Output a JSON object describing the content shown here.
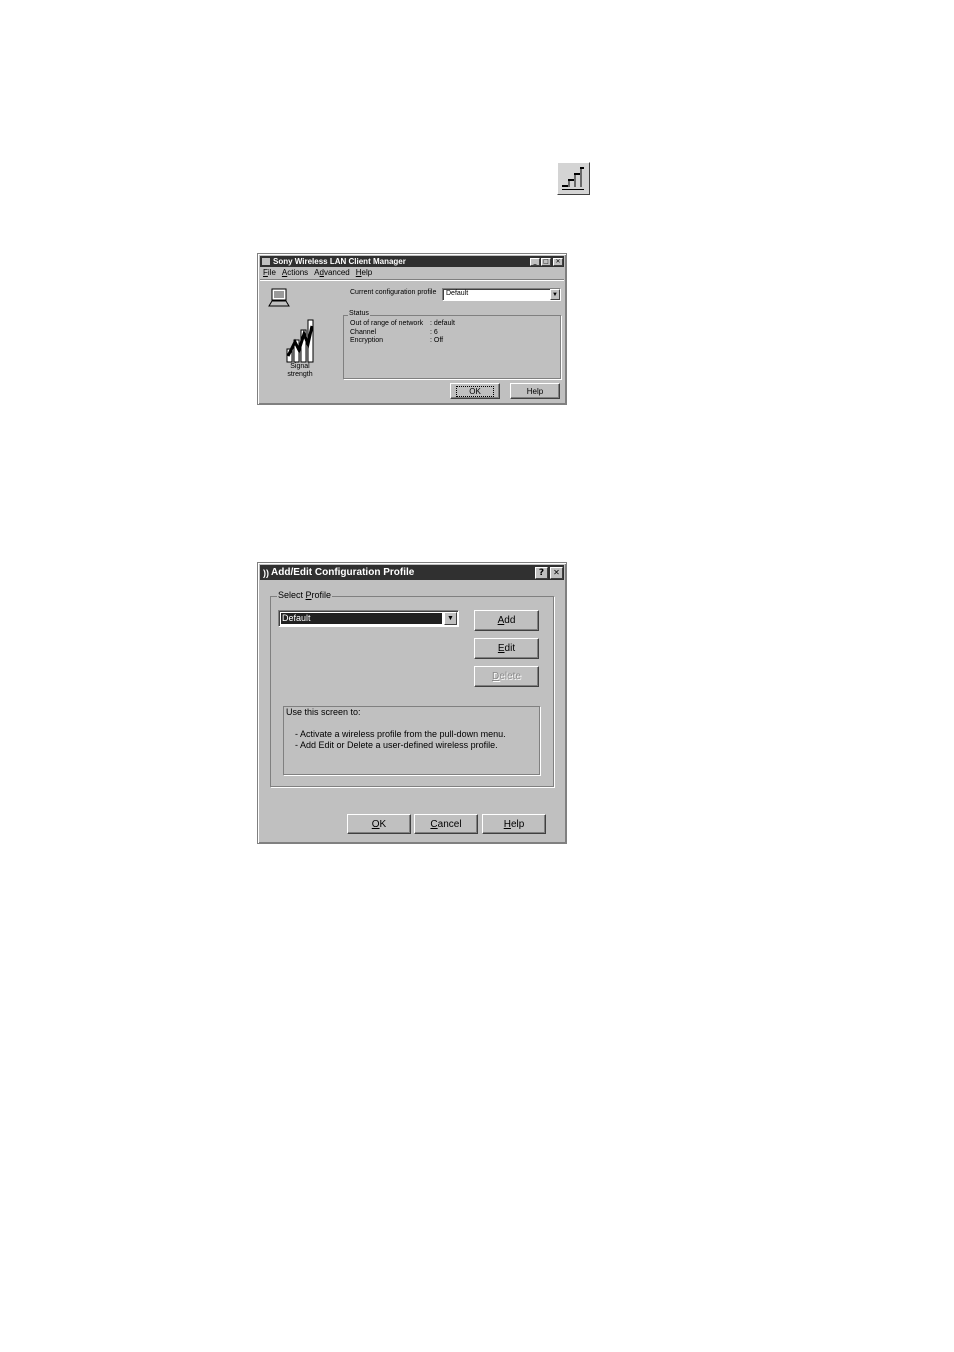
{
  "tray": {
    "icon": "signal-strength-tray-icon"
  },
  "manager_window": {
    "title": "Sony Wireless LAN Client Manager",
    "menu": [
      "File",
      "Actions",
      "Advanced",
      "Help"
    ],
    "config_label": "Current configuration profile",
    "config_value": "Default",
    "signal_label_1": "Signal",
    "signal_label_2": "strength",
    "status": {
      "legend": "Status",
      "rows": [
        {
          "label": "Out of range of network",
          "value": ": default"
        },
        {
          "label": "Channel",
          "value": ": 6"
        },
        {
          "label": "Encryption",
          "value": ": Off"
        }
      ]
    },
    "ok_label": "OK",
    "help_label": "Help"
  },
  "profile_dialog": {
    "title": "Add/Edit Configuration Profile",
    "help_glyph": "?",
    "close_glyph": "✕",
    "group_label": "Select Profile",
    "selected_profile": "Default",
    "add_label": "Add",
    "edit_label": "Edit",
    "delete_label": "Delete",
    "info_heading": "Use this screen to:",
    "info_lines": [
      "-  Activate a wireless profile from the pull-down menu.",
      "-  Add Edit or Delete a user-defined wireless profile."
    ],
    "ok_label": "OK",
    "cancel_label": "Cancel",
    "help_label": "Help"
  }
}
